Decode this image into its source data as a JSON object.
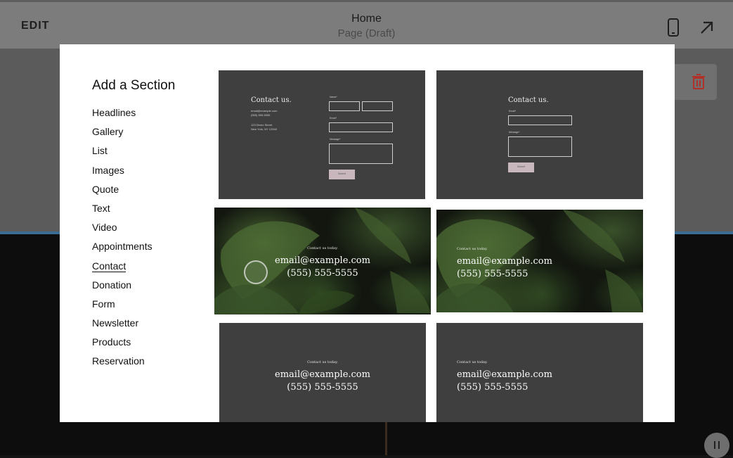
{
  "topbar": {
    "edit_label": "EDIT",
    "title": "Home",
    "subtitle": "Page (Draft)",
    "icons": [
      "mobile-preview-icon",
      "open-external-icon"
    ]
  },
  "background": {
    "trash_icon": "trash-icon",
    "pause_icon": "pause-icon",
    "trash_color": "#b0312a"
  },
  "modal": {
    "heading": "Add a Section",
    "menu": [
      {
        "label": "Headlines"
      },
      {
        "label": "Gallery"
      },
      {
        "label": "List"
      },
      {
        "label": "Images"
      },
      {
        "label": "Quote"
      },
      {
        "label": "Text"
      },
      {
        "label": "Video"
      },
      {
        "label": "Appointments"
      },
      {
        "label": "Contact"
      },
      {
        "label": "Donation"
      },
      {
        "label": "Form"
      },
      {
        "label": "Newsletter"
      },
      {
        "label": "Products"
      },
      {
        "label": "Reservation"
      }
    ],
    "active_item": "Contact",
    "templates": {
      "form_left": {
        "heading": "Contact us.",
        "email": "email@example.com",
        "phone": "(555) 555-5555",
        "address_1": "123 Demo Street",
        "address_2": "New York, NY 12345",
        "name_label": "Name*",
        "email_label": "Email*",
        "message_label": "Message*",
        "submit": "Submit"
      },
      "form_center": {
        "heading": "Contact us.",
        "email_label": "Email*",
        "message_label": "Message*",
        "submit": "Submit"
      },
      "image_center": {
        "small": "Contact us today.",
        "email": "email@example.com",
        "phone": "(555) 555-5555"
      },
      "image_left": {
        "small": "Contact us today.",
        "email": "email@example.com",
        "phone": "(555) 555-5555"
      },
      "dark_center": {
        "small": "Contact us today.",
        "email": "email@example.com",
        "phone": "(555) 555-5555"
      },
      "dark_left": {
        "small": "Contact us today.",
        "email": "email@example.com",
        "phone": "(555) 555-5555"
      }
    }
  }
}
